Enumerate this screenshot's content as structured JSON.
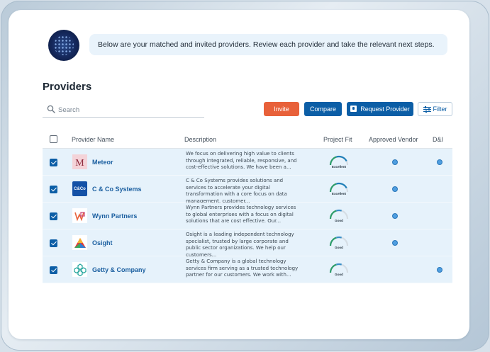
{
  "assistant": {
    "message": "Below are your matched and invited providers. Review each provider and take the relevant next steps."
  },
  "page": {
    "title": "Providers"
  },
  "search": {
    "placeholder": "Search",
    "value": ""
  },
  "toolbar": {
    "invite_label": "Invite",
    "compare_label": "Compare",
    "request_label": "Request Provider",
    "filter_label": "Filter"
  },
  "table": {
    "columns": {
      "name": "Provider Name",
      "description": "Description",
      "project_fit": "Project Fit",
      "approved_vendor": "Approved Vendor",
      "di": "D&I"
    },
    "rows": [
      {
        "name": "Meteor",
        "logo": "meteor-logo",
        "checked": true,
        "description": "We focus on delivering high value to clients through integrated, reliable, responsive, and cost-effective solutions. We have been a...",
        "fit": "Excellent",
        "fit_level": 0.85,
        "approved_vendor": true,
        "di": true
      },
      {
        "name": "C & Co Systems",
        "logo": "cco-logo",
        "logo_text": "C&Co",
        "checked": true,
        "description": "C & Co Systems provides solutions and services to accelerate your digital transformation with a core focus on data management, customer...",
        "fit": "Excellent",
        "fit_level": 0.85,
        "approved_vendor": true,
        "di": false
      },
      {
        "name": "Wynn Partners",
        "logo": "wynn-logo",
        "checked": true,
        "description": "Wynn Partners provides technology services to global enterprises with a focus on digital solutions that are cost effective. Our...",
        "fit": "Good",
        "fit_level": 0.6,
        "approved_vendor": true,
        "di": false
      },
      {
        "name": "Osight",
        "logo": "osight-logo",
        "checked": true,
        "description": "Osight is a leading independent technology specialist, trusted by large corporate and public sector organizations. We help our customers...",
        "fit": "Good",
        "fit_level": 0.6,
        "approved_vendor": true,
        "di": false
      },
      {
        "name": "Getty & Company",
        "logo": "getty-logo",
        "checked": true,
        "description": "Getty & Company is a global technology services firm serving as a trusted technology partner for our customers. We work with...",
        "fit": "Good",
        "fit_level": 0.6,
        "approved_vendor": false,
        "di": true
      }
    ]
  },
  "colors": {
    "primary": "#0c5ea6",
    "accent": "#e8613a",
    "row_highlight": "#e6f2fb",
    "gauge_excellent": "#1e8a5a",
    "gauge_good": "#3a8fc8"
  }
}
